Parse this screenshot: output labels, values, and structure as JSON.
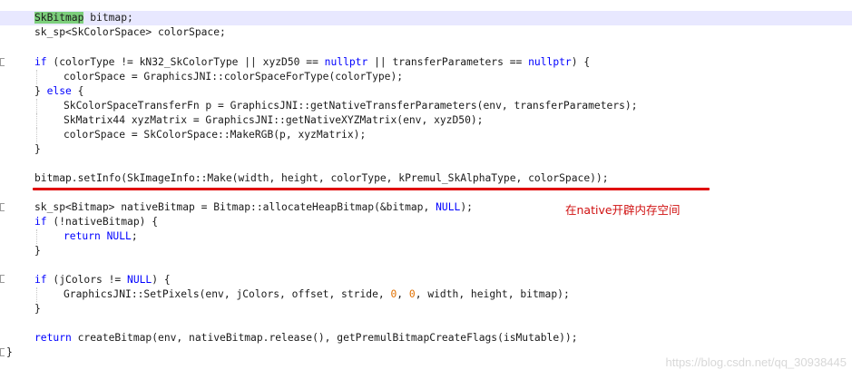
{
  "code": {
    "line1_symbol": "SkBitmap",
    "line1_rest": " bitmap;",
    "line2": "sk_sp<SkColorSpace> colorSpace;",
    "line3_if": "if",
    "line3_a": " (colorType != kN32_SkColorType || xyzD50 == ",
    "line3_null1": "nullptr",
    "line3_b": " || transferParameters == ",
    "line3_null2": "nullptr",
    "line3_c": ") {",
    "line4": "colorSpace = GraphicsJNI::colorSpaceForType(colorType);",
    "line5_open": "} ",
    "line5_else": "else",
    "line5_close": " {",
    "line6": "SkColorSpaceTransferFn p = GraphicsJNI::getNativeTransferParameters(env, transferParameters);",
    "line7": "SkMatrix44 xyzMatrix = GraphicsJNI::getNativeXYZMatrix(env, xyzD50);",
    "line8": "colorSpace = SkColorSpace::MakeRGB(p, xyzMatrix);",
    "line9": "}",
    "line10": "bitmap.setInfo(SkImageInfo::Make(width, height, colorType, kPremul_SkAlphaType, colorSpace));",
    "line11_a": "sk_sp<Bitmap> nativeBitmap = Bitmap::allocateHeapBitmap(&bitmap, ",
    "line11_null": "NULL",
    "line11_b": ");",
    "line12_if": "if",
    "line12_rest": " (!nativeBitmap) {",
    "line13_return": "return",
    "line13_sp": " ",
    "line13_null": "NULL",
    "line13_semi": ";",
    "line14": "}",
    "line15_if": "if",
    "line15_a": " (jColors != ",
    "line15_null": "NULL",
    "line15_b": ") {",
    "line16_a": "GraphicsJNI::SetPixels(env, jColors, offset, stride, ",
    "line16_zero1": "0",
    "line16_comma": ", ",
    "line16_zero2": "0",
    "line16_b": ", width, height, bitmap);",
    "line17": "}",
    "line18_return": "return",
    "line18_rest": " createBitmap(env, nativeBitmap.release(), getPremulBitmapCreateFlags(isMutable));",
    "line19": "}"
  },
  "annotation": "在native开辟内存空间",
  "watermark": "https://blog.csdn.net/qq_30938445",
  "colors": {
    "keyword": "#0000ff",
    "number": "#e07000",
    "highlight_line": "#e8e8ff",
    "symbol_highlight": "#7ccf7c",
    "underline": "#e00000",
    "annotation": "#d01010"
  }
}
